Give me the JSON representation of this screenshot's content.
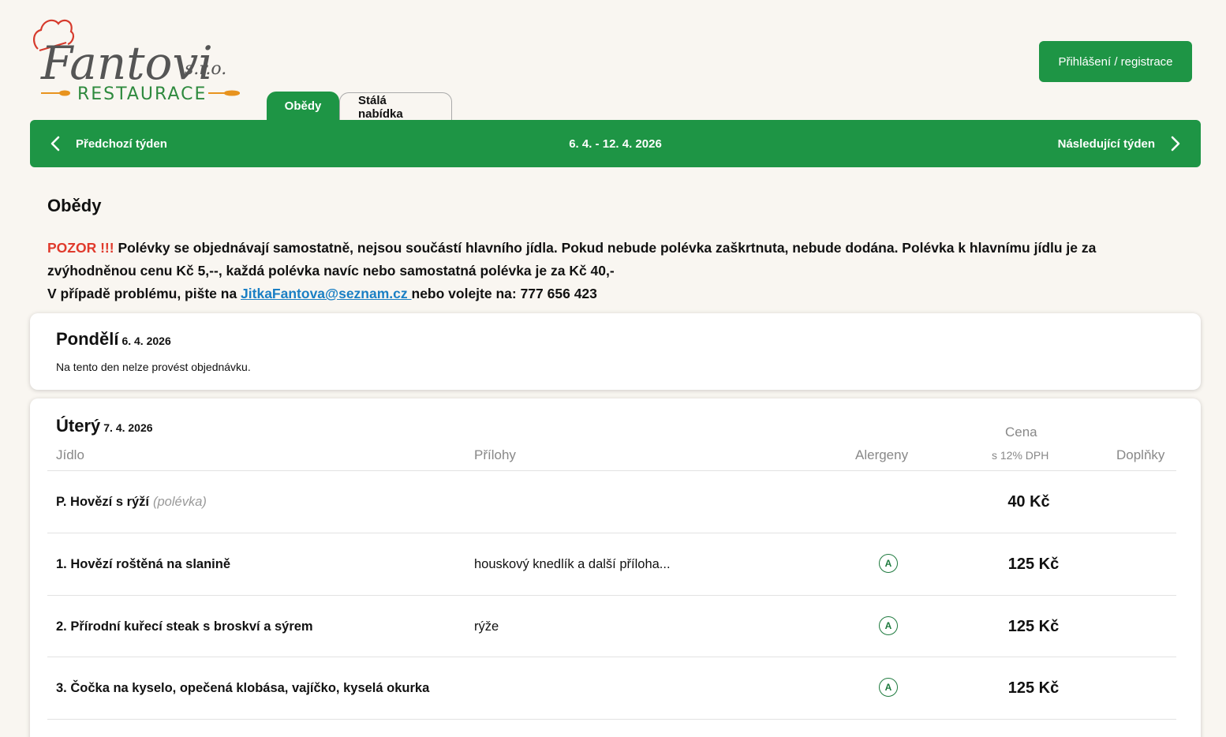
{
  "logo": {
    "brand": "Fantovi",
    "suffix": "s.r.o.",
    "subtitle": "RESTAURACE"
  },
  "header": {
    "login_label": "Přihlášení / registrace"
  },
  "tabs": [
    {
      "label": "Obědy",
      "active": true
    },
    {
      "label": "Stálá nabídka",
      "active": false
    }
  ],
  "week": {
    "prev_label": "Předchozí týden",
    "range": "6. 4. - 12. 4. 2026",
    "next_label": "Následující týden"
  },
  "section": {
    "title": "Obědy"
  },
  "notice": {
    "warn": "POZOR !!!",
    "line1": " Polévky se objednávají samostatně, nejsou součástí hlavního jídla. Pokud nebude polévka zaškrtnuta, nebude dodána. Polévka k hlavnímu jídlu je za zvýhodněnou cenu Kč 5,--, každá polévka navíc nebo samostatná polévka je za Kč 40,-",
    "line2_prefix": "V případě problému, pište na ",
    "email": "JitkaFantova@seznam.cz ",
    "line2_suffix": "nebo volejte na: 777 656 423"
  },
  "days": [
    {
      "name": "Pondělí",
      "date": "6. 4. 2026",
      "note": "Na tento den nelze provést objednávku."
    },
    {
      "name": "Úterý",
      "date": "7. 4. 2026",
      "columns": {
        "meal": "Jídlo",
        "sides": "Přílohy",
        "allergens": "Alergeny",
        "price": "Cena",
        "price_note": "s 12% DPH",
        "extras": "Doplňky"
      },
      "items": [
        {
          "name": "P. Hovězí s rýží",
          "hint": "(polévka)",
          "sides": "",
          "allergen": "",
          "price": "40 Kč"
        },
        {
          "name": "1. Hovězí roštěná na slanině",
          "hint": "",
          "sides": "houskový knedlík a další příloha...",
          "allergen": "A",
          "price": "125 Kč"
        },
        {
          "name": "2. Přírodní kuřecí steak s broskví a sýrem",
          "hint": "",
          "sides": "rýže",
          "allergen": "A",
          "price": "125 Kč"
        },
        {
          "name": "3. Čočka na kyselo, opečená klobása, vajíčko, kyselá okurka",
          "hint": "",
          "sides": "",
          "allergen": "A",
          "price": "125 Kč"
        }
      ]
    }
  ],
  "colors": {
    "primary": "#1e9545",
    "warn": "#e03a2c",
    "link": "#1a7fc4",
    "logo_red": "#d63a2c",
    "logo_orange": "#e8931e"
  }
}
